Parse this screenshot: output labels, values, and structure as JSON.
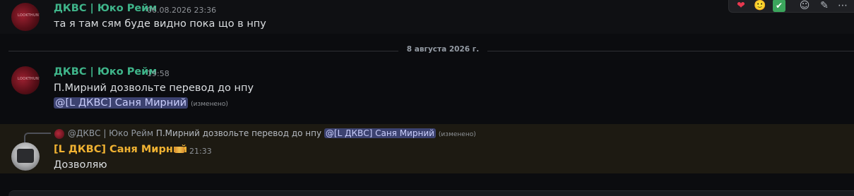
{
  "messages": [
    {
      "author": "ДКВС | Юко Рейм",
      "timestamp": "06.08.2026 23:36",
      "lines": [
        "та я там сям буде видно пока що в нпу"
      ],
      "avatar_text": "LOOKTHUNT"
    },
    {
      "author": "ДКВС | Юко Рейм",
      "timestamp": "19:58",
      "lines": [
        "П.Мирний дозвольте перевод до нпу"
      ],
      "mention": "@[L ДКВС] Саня Мирний",
      "edited": "(изменено)",
      "avatar_text": "LOOKTHUNT"
    },
    {
      "author": "[L ДКВС] Саня Мирний",
      "timestamp": "21:33",
      "lines": [
        "Дозволяю"
      ],
      "reply": {
        "author": "@ДКВС | Юко Рейм",
        "text": "П.Мирний дозвольте перевод до нпу",
        "mention": "@[L ДКВС] Саня Мирний",
        "edited": "(изменено)"
      }
    }
  ],
  "divider": {
    "label": "8 августа 2026 г."
  },
  "toolbar": {
    "icons": [
      "heart-reaction-icon",
      "slightly-smiling-reaction-icon",
      "check-reaction-icon",
      "add-reaction-icon",
      "edit-icon",
      "more-icon"
    ],
    "glyphs": [
      "❤",
      "🙂",
      "✔",
      "☺",
      "✎",
      "⋯"
    ]
  },
  "colors": {
    "author_teal": "#3fb58a",
    "author_gold": "#f0b232",
    "mention_bg": "#3c4270",
    "highlight_bg": "#1d1a12"
  }
}
